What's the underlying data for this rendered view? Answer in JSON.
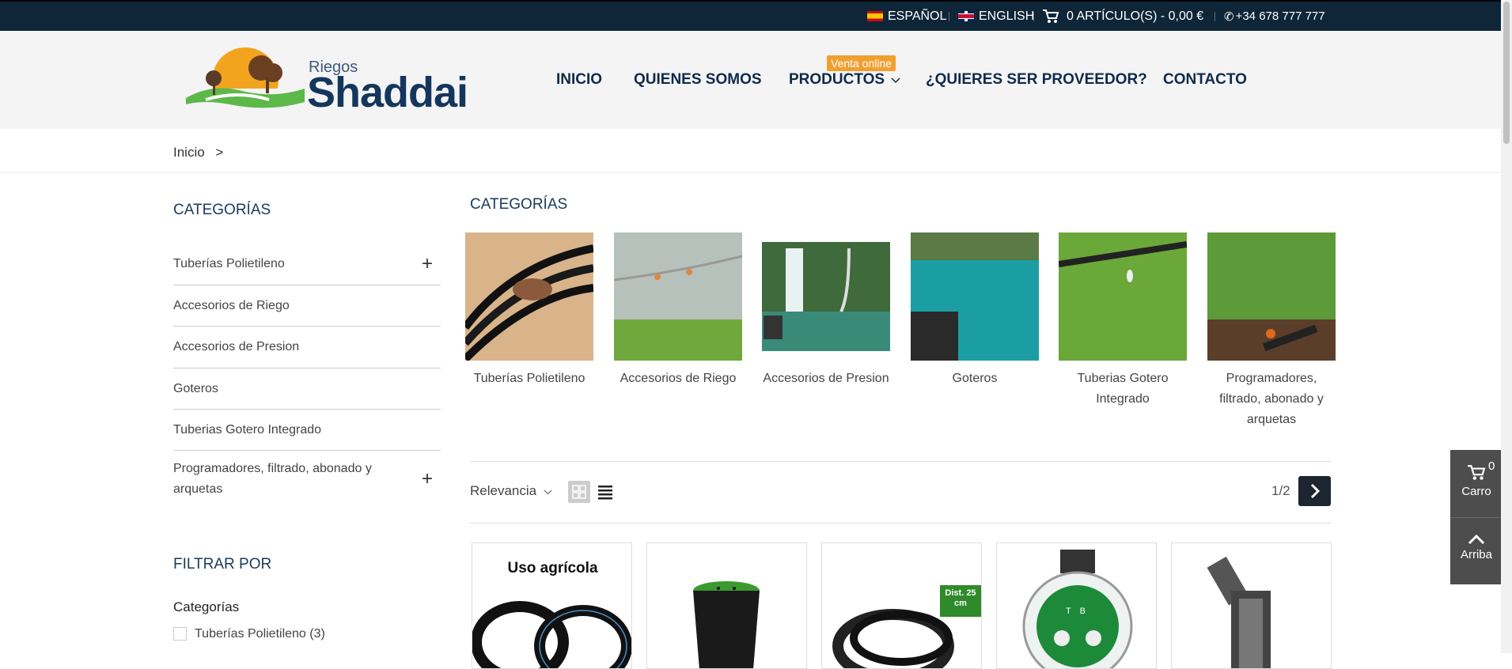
{
  "topbar": {
    "lang_es": "ESPAÑOL",
    "lang_en": "ENGLISH",
    "cart": "0 ARTÍCULO(S) - 0,00 €",
    "phone": "+34 678 777 777"
  },
  "logo": {
    "small": "Riegos",
    "big": "Shaddai"
  },
  "nav": {
    "items": [
      "INICIO",
      "QUIENES SOMOS",
      "PRODUCTOS",
      "¿QUIERES SER PROVEEDOR?",
      "CONTACTO"
    ],
    "badge": "Venta online"
  },
  "breadcrumb": {
    "home": "Inicio",
    "sep": ">"
  },
  "sidebar": {
    "title": "CATEGORÍAS",
    "items": [
      {
        "label": "Tuberías Polietileno",
        "expand": "+"
      },
      {
        "label": "Accesorios de Riego"
      },
      {
        "label": "Accesorios de Presion"
      },
      {
        "label": "Goteros"
      },
      {
        "label": "Tuberias Gotero Integrado"
      },
      {
        "label": "Programadores, filtrado, abonado y arquetas",
        "expand": "+"
      }
    ],
    "filter_title": "FILTRAR POR",
    "filter_group": "Categorías",
    "filter_option": "Tuberías Polietileno (3)"
  },
  "main": {
    "title": "CATEGORÍAS",
    "categories": [
      {
        "label": "Tuberías Polietileno"
      },
      {
        "label": "Accesorios de Riego"
      },
      {
        "label": "Accesorios de Presion"
      },
      {
        "label": "Goteros"
      },
      {
        "label": "Tuberias Gotero Integrado"
      },
      {
        "label": "Programadores, filtrado, abonado y arquetas"
      }
    ],
    "sort": "Relevancia",
    "pager": "1/2"
  },
  "products": {
    "p1_text": "Uso agrícola",
    "p3_badge": "Dist. 25 cm",
    "p4_text": "T B"
  },
  "widget": {
    "cart_count": "0",
    "cart_label": "Carro",
    "top_label": "Arriba"
  },
  "colors": {
    "topbar": "#0f2638",
    "nav": "#0f2a4a",
    "badge": "#f0a030",
    "widget": "#4d4d4d"
  }
}
